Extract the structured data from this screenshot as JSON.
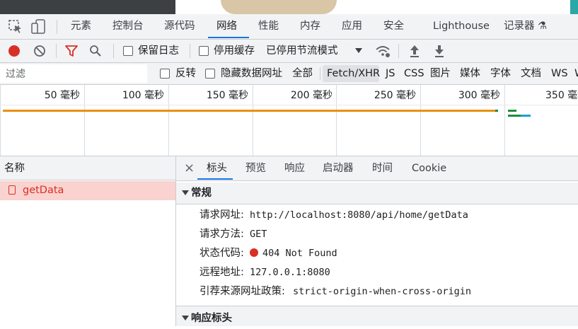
{
  "tabs": [
    "元素",
    "控制台",
    "源代码",
    "网络",
    "性能",
    "内存",
    "应用",
    "安全",
    "Lighthouse",
    "记录器 ⚗"
  ],
  "active_tab": "网络",
  "toolbar": {
    "preserve_log": "保留日志",
    "disable_cache": "停用缓存",
    "throttling": "已停用节流模式",
    "record_icon": "record-icon",
    "clear_icon": "clear-icon",
    "filter_icon": "filter-icon",
    "search_icon": "search-icon"
  },
  "filter_bar": {
    "placeholder": "过滤",
    "invert": "反转",
    "hide_data_urls": "隐藏数据网址",
    "types": [
      "全部",
      "Fetch/XHR",
      "JS",
      "CSS",
      "图片",
      "媒体",
      "字体",
      "文档",
      "WS",
      "W"
    ],
    "active_type": "Fetch/XHR"
  },
  "overview": {
    "ticks": [
      "50 毫秒",
      "100 毫秒",
      "150 毫秒",
      "200 毫秒",
      "250 毫秒",
      "300 毫秒",
      "350 毫秒"
    ]
  },
  "request_list": {
    "header": "名称",
    "requests": [
      {
        "name": "getData",
        "status": "error"
      }
    ]
  },
  "details": {
    "close": "×",
    "tabs": [
      "标头",
      "预览",
      "响应",
      "启动器",
      "时间",
      "Cookie"
    ],
    "active_tab": "标头",
    "general_title": "常规",
    "general": [
      {
        "key": "请求网址:",
        "value": "http://localhost:8080/api/home/getData"
      },
      {
        "key": "请求方法:",
        "value": "GET"
      },
      {
        "key": "状态代码:",
        "value": "404 Not Found"
      },
      {
        "key": "远程地址:",
        "value": "127.0.0.1:8080"
      },
      {
        "key": "引荐来源网址政策:",
        "value": "strict-origin-when-cross-origin"
      }
    ],
    "response_headers_title": "响应标头"
  },
  "colors": {
    "accent": "#1a73e8",
    "error": "#d93025",
    "timeline": "#e8900c"
  }
}
